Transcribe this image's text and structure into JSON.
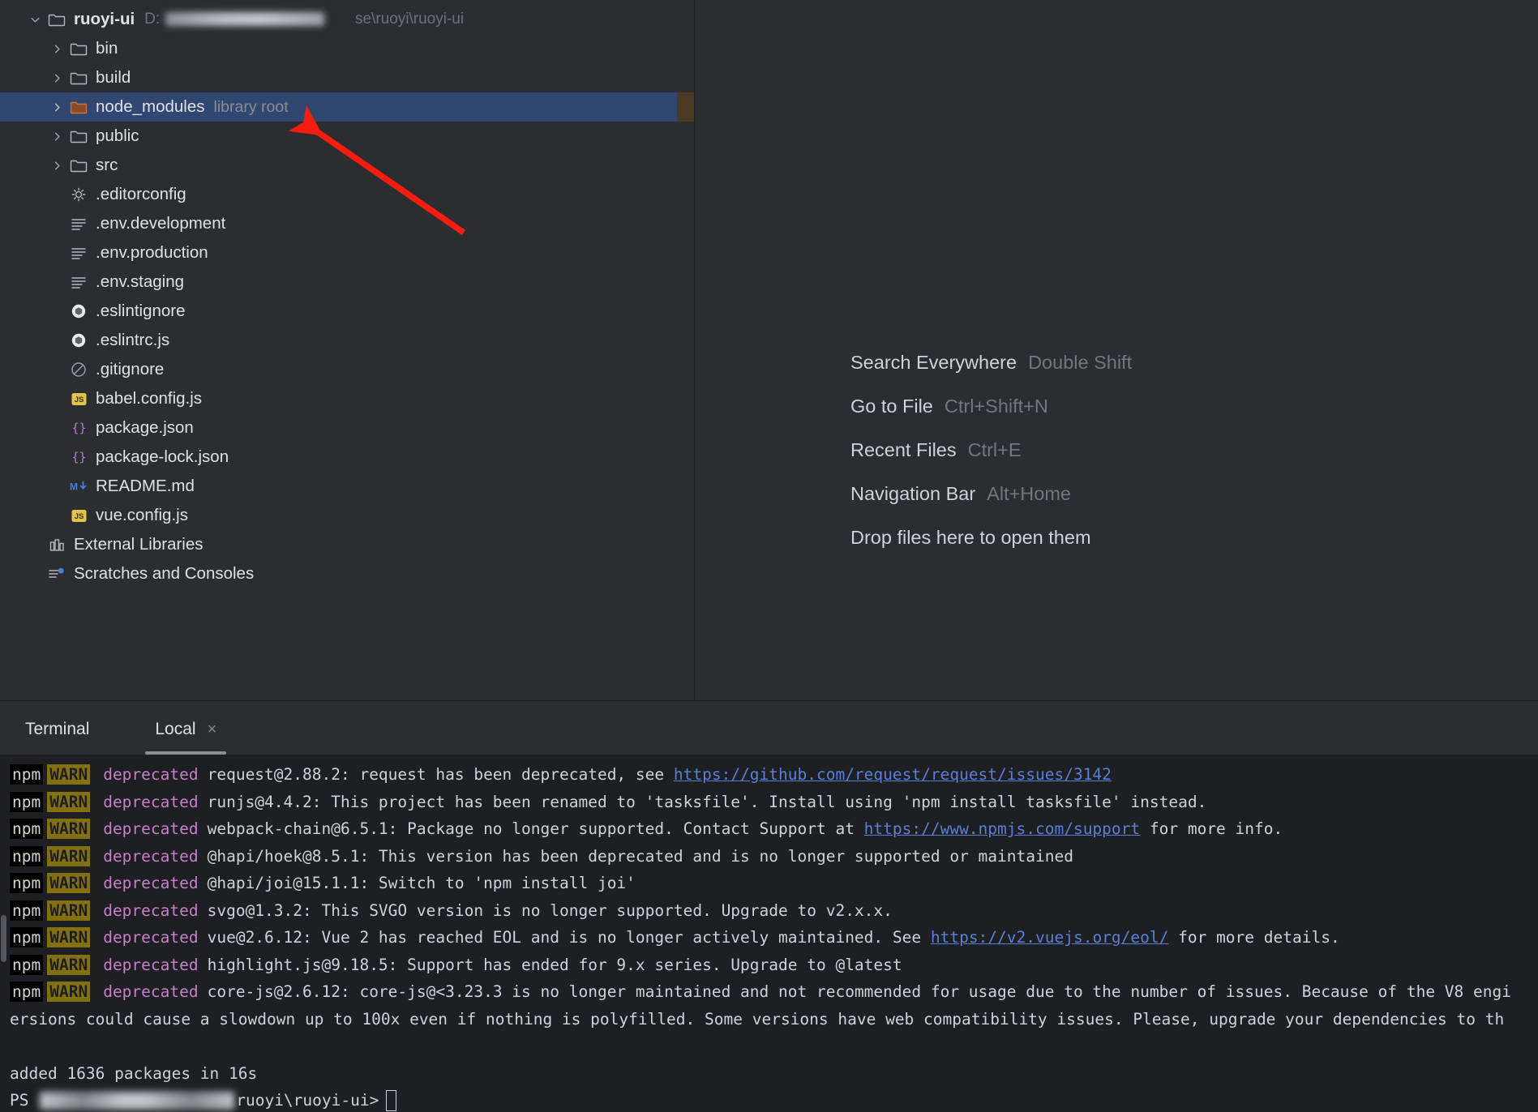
{
  "project_tree": {
    "root": {
      "name": "ruoyi-ui",
      "path_suffix": "se\\ruoyi\\ruoyi-ui",
      "path_prefix": "D:",
      "expanded": true
    },
    "folders": [
      {
        "name": "bin",
        "icon": "folder-icon"
      },
      {
        "name": "build",
        "icon": "folder-icon"
      },
      {
        "name": "node_modules",
        "icon": "folder-orange-icon",
        "badge": "library root",
        "selected": true
      },
      {
        "name": "public",
        "icon": "folder-icon"
      },
      {
        "name": "src",
        "icon": "folder-icon"
      }
    ],
    "files": [
      {
        "name": ".editorconfig",
        "icon": "gear-icon"
      },
      {
        "name": ".env.development",
        "icon": "text-lines-icon"
      },
      {
        "name": ".env.production",
        "icon": "text-lines-icon"
      },
      {
        "name": ".env.staging",
        "icon": "text-lines-icon"
      },
      {
        "name": ".eslintignore",
        "icon": "eslint-icon"
      },
      {
        "name": ".eslintrc.js",
        "icon": "eslint-icon"
      },
      {
        "name": ".gitignore",
        "icon": "ignore-icon"
      },
      {
        "name": "babel.config.js",
        "icon": "js-icon"
      },
      {
        "name": "package.json",
        "icon": "json-icon"
      },
      {
        "name": "package-lock.json",
        "icon": "json-icon"
      },
      {
        "name": "README.md",
        "icon": "markdown-icon"
      },
      {
        "name": "vue.config.js",
        "icon": "js-icon"
      }
    ],
    "extra_nodes": [
      {
        "name": "External Libraries",
        "icon": "libraries-icon"
      },
      {
        "name": "Scratches and Consoles",
        "icon": "scratches-icon"
      }
    ]
  },
  "editor_placeholder": {
    "shortcuts": [
      {
        "label": "Search Everywhere",
        "keys": "Double Shift"
      },
      {
        "label": "Go to File",
        "keys": "Ctrl+Shift+N"
      },
      {
        "label": "Recent Files",
        "keys": "Ctrl+E"
      },
      {
        "label": "Navigation Bar",
        "keys": "Alt+Home"
      }
    ],
    "drop_hint": "Drop files here to open them"
  },
  "terminal": {
    "tool_window_title": "Terminal",
    "tabs": [
      {
        "label": "Local",
        "active": true,
        "close_icon": "×"
      }
    ],
    "lines": [
      {
        "npm": "npm",
        "warn": "WARN",
        "dep": "deprecated",
        "pre": "request@2.88.2: request has been deprecated, see ",
        "link": "https://github.com/request/request/issues/3142",
        "post": ""
      },
      {
        "npm": "npm",
        "warn": "WARN",
        "dep": "deprecated",
        "pre": "runjs@4.4.2: This project has been renamed to 'tasksfile'. Install using 'npm install tasksfile' instead.",
        "link": "",
        "post": ""
      },
      {
        "npm": "npm",
        "warn": "WARN",
        "dep": "deprecated",
        "pre": "webpack-chain@6.5.1: Package no longer supported. Contact Support at ",
        "link": "https://www.npmjs.com/support",
        "post": " for more info."
      },
      {
        "npm": "npm",
        "warn": "WARN",
        "dep": "deprecated",
        "pre": "@hapi/hoek@8.5.1: This version has been deprecated and is no longer supported or maintained",
        "link": "",
        "post": ""
      },
      {
        "npm": "npm",
        "warn": "WARN",
        "dep": "deprecated",
        "pre": "@hapi/joi@15.1.1: Switch to 'npm install joi'",
        "link": "",
        "post": ""
      },
      {
        "npm": "npm",
        "warn": "WARN",
        "dep": "deprecated",
        "pre": "svgo@1.3.2: This SVGO version is no longer supported. Upgrade to v2.x.x.",
        "link": "",
        "post": ""
      },
      {
        "npm": "npm",
        "warn": "WARN",
        "dep": "deprecated",
        "pre": "vue@2.6.12: Vue 2 has reached EOL and is no longer actively maintained. See ",
        "link": "https://v2.vuejs.org/eol/",
        "post": " for more details."
      },
      {
        "npm": "npm",
        "warn": "WARN",
        "dep": "deprecated",
        "pre": "highlight.js@9.18.5: Support has ended for 9.x series. Upgrade to @latest",
        "link": "",
        "post": ""
      },
      {
        "npm": "npm",
        "warn": "WARN",
        "dep": "deprecated",
        "pre": "core-js@2.6.12: core-js@<3.23.3 is no longer maintained and not recommended for usage due to the number of issues. Because of the V8 engi",
        "link": "",
        "post": ""
      }
    ],
    "wrapped_line": "ersions could cause a slowdown up to 100x even if nothing is polyfilled. Some versions have web compatibility issues. Please, upgrade your dependencies to th",
    "summary": "added 1636 packages in 16s",
    "prompt_prefix": "PS",
    "prompt_suffix": "ruoyi\\ruoyi-ui>"
  },
  "annotation": {
    "type": "arrow",
    "color": "#f51c10",
    "points_to": "node_modules library root"
  },
  "colors": {
    "background": "#2b2d30",
    "terminal_background": "#1e1f22",
    "selection": "#2f4771",
    "selection_strip": "#4a3a25",
    "link": "#5a7fd6",
    "warn_badge": "#837011",
    "deprecated_text": "#c77fc9",
    "arrow": "#f51c10"
  }
}
